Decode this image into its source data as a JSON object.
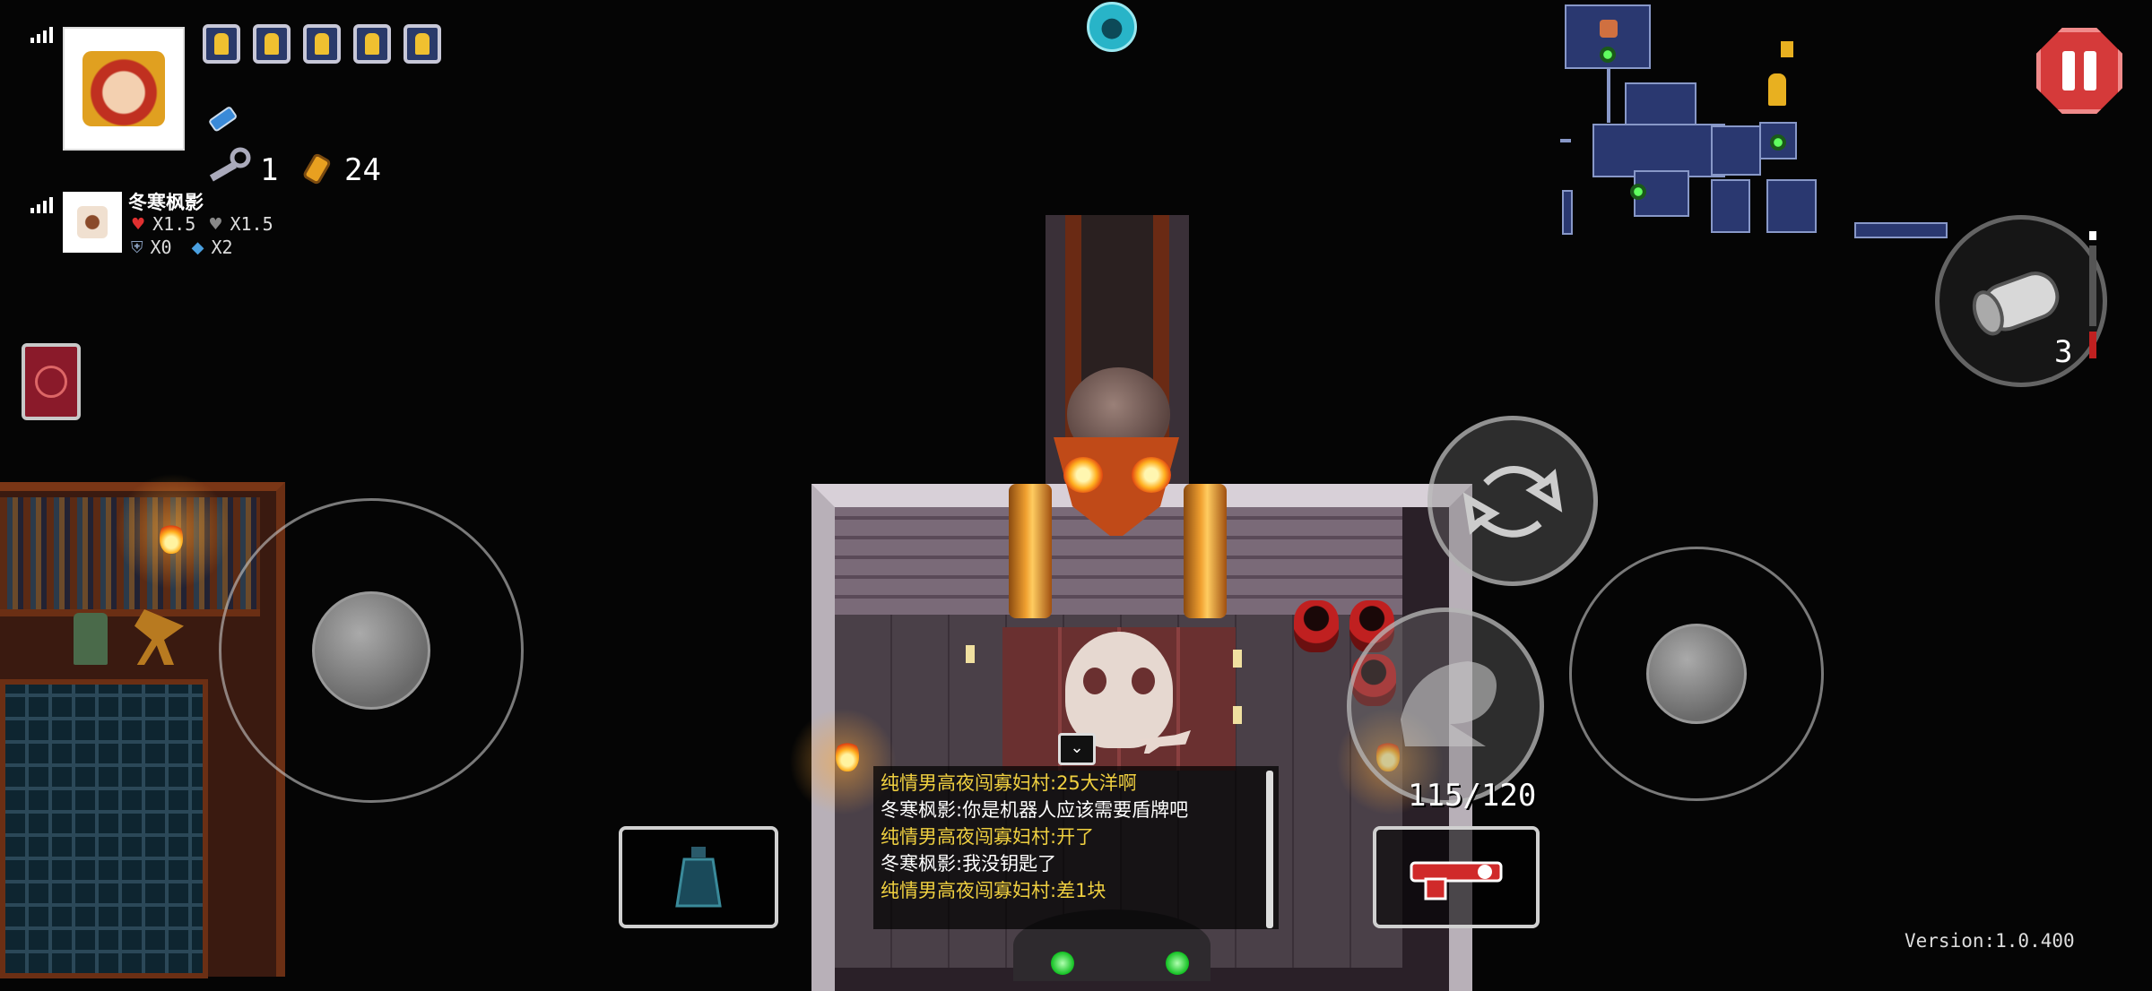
{
  "hud": {
    "blanks_count": 5,
    "keys_count": "1",
    "shells_count": "24",
    "ammo": "115/120",
    "active_item_charges": "3",
    "version": "Version:1.0.400"
  },
  "player2": {
    "name": "冬寒枫影",
    "damage_mult": "X1.5",
    "health_mult": "X1.5",
    "armor": "X0",
    "blanks": "X2"
  },
  "chat": {
    "messages": [
      {
        "text": "纯情男高夜闯寡妇村:25大洋啊",
        "color": "#f0d040"
      },
      {
        "text": "冬寒枫影:你是机器人应该需要盾牌吧",
        "color": "#ffffff"
      },
      {
        "text": "纯情男高夜闯寡妇村:开了",
        "color": "#f0d040"
      },
      {
        "text": "冬寒枫影:我没钥匙了",
        "color": "#ffffff"
      },
      {
        "text": "纯情男高夜闯寡妇村:差1块",
        "color": "#f0d040"
      }
    ]
  },
  "icons": {
    "pause": "pause-icon",
    "coop": "person-icon",
    "key": "key-icon",
    "shell": "shell-casing-icon",
    "blank": "blank-icon",
    "reload": "reload-icon",
    "dodge": "dodge-roll-icon",
    "active_item": "active-item-icon"
  },
  "colors": {
    "pause_red": "#d53a3a",
    "coop_cyan": "#28b4c8",
    "minimap_room": "#2a3870",
    "chat_yellow": "#f0d040"
  }
}
